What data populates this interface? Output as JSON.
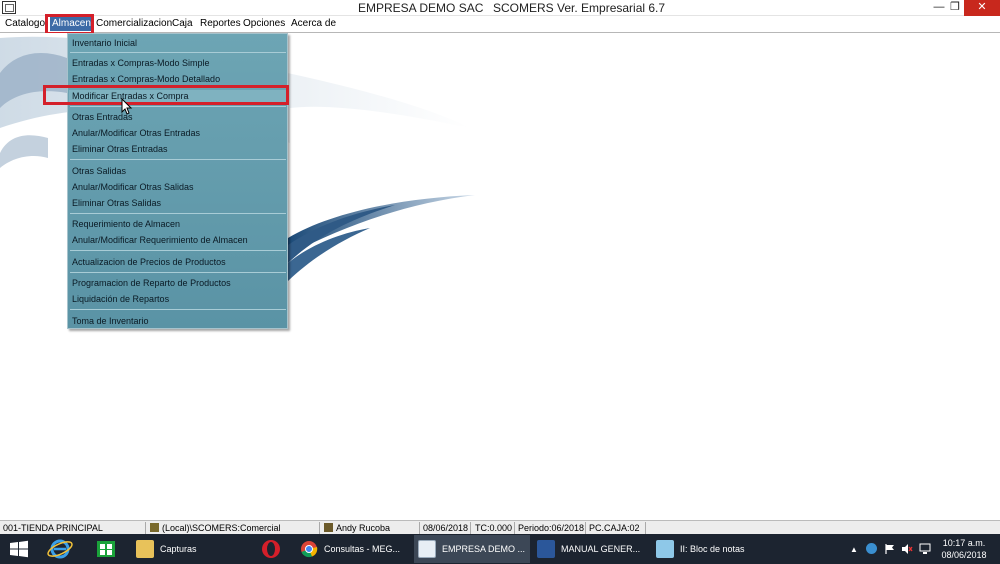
{
  "title_bar": {
    "title": "EMPRESA DEMO SAC",
    "version": "SCOMERS Ver. Empresarial  6.7",
    "minimize_glyph": "—",
    "restore_glyph": "❐",
    "close_glyph": "✕"
  },
  "menu": {
    "items": [
      "Catalogo",
      "Almacen",
      "Comercializacion",
      "Caja",
      "Reportes",
      "Opciones",
      "Acerca de"
    ],
    "active": "Almacen"
  },
  "almacen_menu": {
    "items": [
      "Inventario Inicial",
      "Entradas x Compras-Modo Simple",
      "Entradas x Compras-Modo Detallado",
      "Modificar Entradas x Compra",
      "Otras Entradas",
      "Anular/Modificar Otras Entradas",
      "Eliminar Otras Entradas",
      "Otras Salidas",
      "Anular/Modificar Otras Salidas",
      "Eliminar Otras Salidas",
      "Requerimiento de Almacen",
      "Anular/Modificar Requerimiento de Almacen",
      "Actualizacion de Precios de Productos",
      "Programacion de Reparto de Productos",
      "Liquidación de Repartos",
      "Toma de Inventario"
    ],
    "highlighted": "Modificar Entradas x Compra"
  },
  "status_bar": {
    "store": "001-TIENDA PRINCIPAL",
    "database": "(Local)\\SCOMERS:Comercial",
    "user": "Andy Rucoba",
    "date": "08/06/2018",
    "exchange_rate": "TC:0.000",
    "period": "Periodo:06/2018",
    "terminal": "PC.CAJA:02"
  },
  "taskbar": {
    "tasks": [
      {
        "label": "Capturas",
        "icon": "folder-icon"
      },
      {
        "label": "",
        "icon": "opera-icon"
      },
      {
        "label": "Consultas - MEG...",
        "icon": "chrome-icon"
      },
      {
        "label": "EMPRESA DEMO ...",
        "icon": "scomers-icon"
      },
      {
        "label": "MANUAL GENER...",
        "icon": "word-icon"
      },
      {
        "label": "II: Bloc de notas",
        "icon": "notepad-icon"
      }
    ],
    "clock_time": "10:17 a.m.",
    "clock_date": "08/06/2018"
  },
  "colors": {
    "menu_bg": "#6da5b4",
    "highlight_box": "#d4202a",
    "taskbar": "#1c2430"
  }
}
